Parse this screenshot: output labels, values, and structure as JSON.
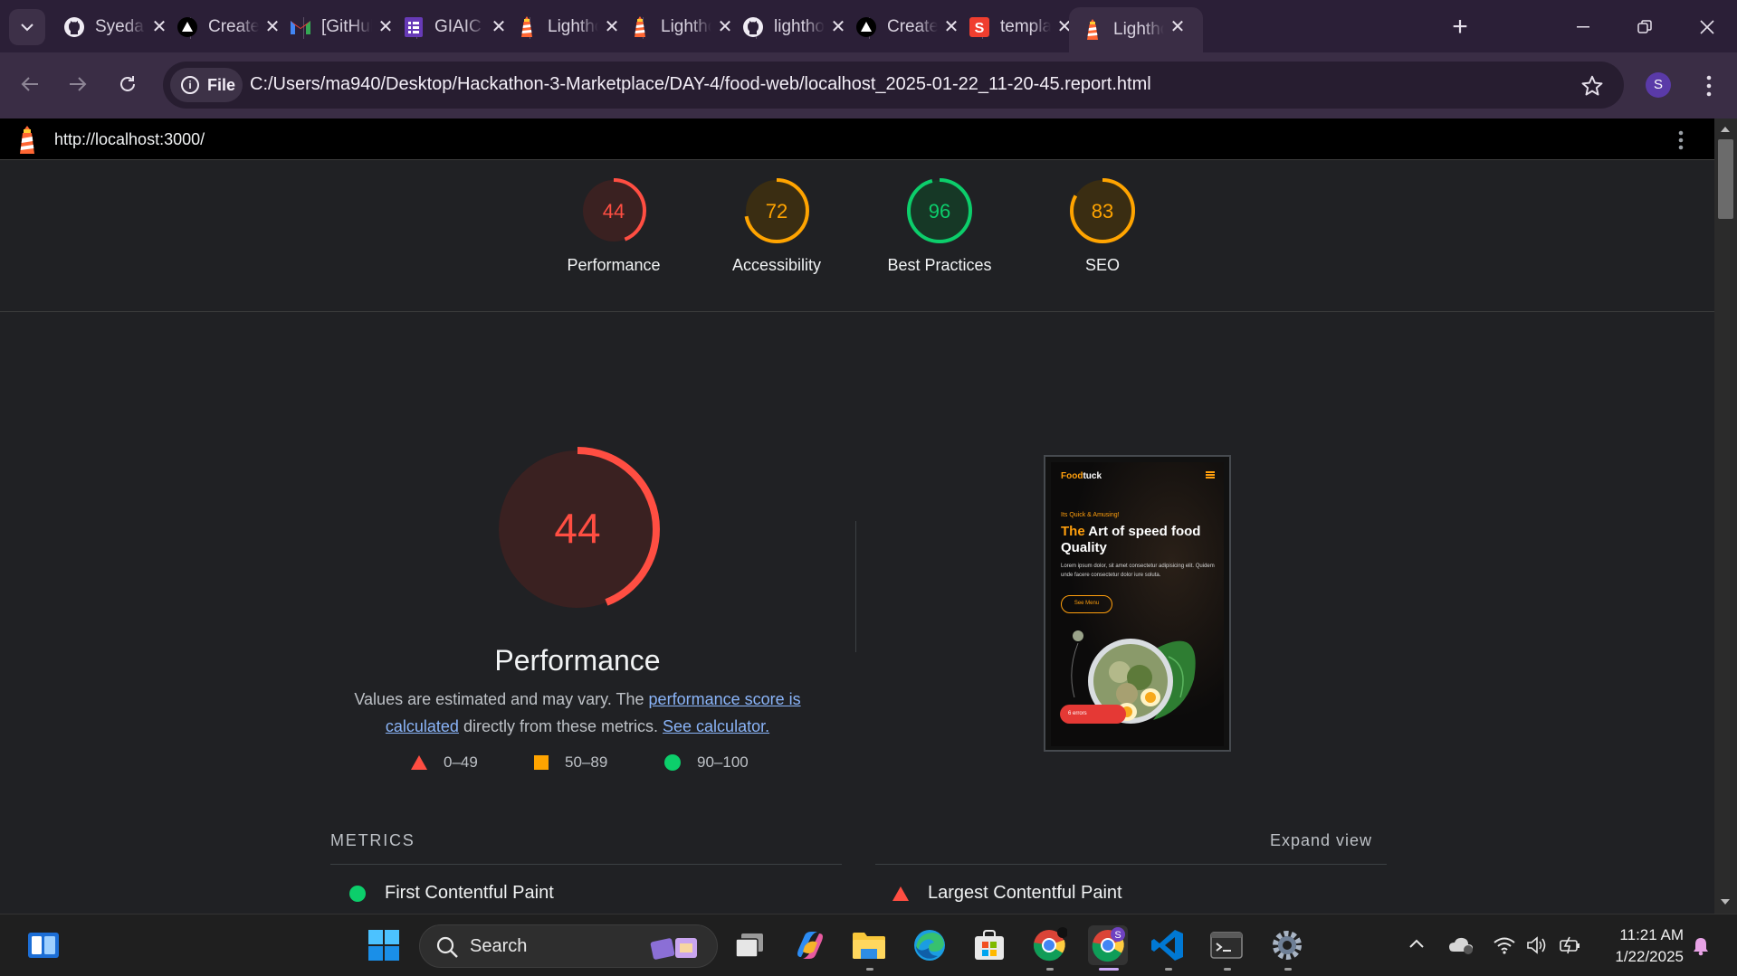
{
  "browser": {
    "tabs": [
      {
        "title": "Syeda",
        "icon": "github-icon"
      },
      {
        "title": "Create",
        "icon": "vercel-icon"
      },
      {
        "title": "[GitHub]",
        "icon": "gmail-icon"
      },
      {
        "title": "GIAIC",
        "icon": "forms-icon"
      },
      {
        "title": "Lighthouse",
        "icon": "lighthouse-icon"
      },
      {
        "title": "Lighthouse",
        "icon": "lighthouse-icon"
      },
      {
        "title": "lighthouse",
        "icon": "github-icon"
      },
      {
        "title": "Create",
        "icon": "vercel-icon"
      },
      {
        "title": "template",
        "icon": "sanity-icon"
      },
      {
        "title": "Lighthouse",
        "icon": "lighthouse-icon",
        "active": true
      }
    ],
    "address": {
      "chip_label": "File",
      "url": "C:/Users/ma940/Desktop/Hackathon-3-Marketplace/DAY-4/food-web/localhost_2025-01-22_11-20-45.report.html"
    },
    "profile_initial": "S"
  },
  "report": {
    "tested_url": "http://localhost:3000/",
    "summary_scores": [
      {
        "label": "Performance",
        "score": "44",
        "rating": "fail"
      },
      {
        "label": "Accessibility",
        "score": "72",
        "rating": "average"
      },
      {
        "label": "Best Practices",
        "score": "96",
        "rating": "pass"
      },
      {
        "label": "SEO",
        "score": "83",
        "rating": "average"
      }
    ],
    "performance": {
      "score": "44",
      "score_fraction": 0.44,
      "title": "Performance",
      "desc_prefix": "Values are estimated and may vary. The ",
      "desc_link1": "performance score is calculated",
      "desc_middle": " directly from these metrics. ",
      "desc_link2": "See calculator."
    },
    "legend": [
      {
        "label": "0–49",
        "shape": "triangle"
      },
      {
        "label": "50–89",
        "shape": "square"
      },
      {
        "label": "90–100",
        "shape": "circle"
      }
    ],
    "metrics_heading": "METRICS",
    "expand_label": "Expand view",
    "metrics": [
      {
        "label": "First Contentful Paint",
        "rating": "pass"
      },
      {
        "label": "Largest Contentful Paint",
        "rating": "fail"
      }
    ],
    "screenshot": {
      "brand_a": "Food",
      "brand_b": "tuck",
      "kicker": "Its Quick & Amusing!",
      "headline_accent": "The",
      "headline_rest": " Art of speed food Quality",
      "body": "Lorem ipsum dolor, sit amet consectetur adipisicing elit. Quidem unde facere consectetur dolor iure soluta.",
      "button": "See Menu",
      "error_badge": "6 errors"
    }
  },
  "colors": {
    "fail": "#ff4e42",
    "average": "#ffa400",
    "pass": "#0cce6b"
  },
  "taskbar": {
    "search_placeholder": "Search",
    "time": "11:21 AM",
    "date": "1/22/2025"
  }
}
